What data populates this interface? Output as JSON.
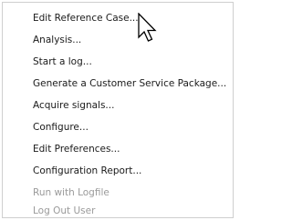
{
  "menu": {
    "items": [
      {
        "label": "Edit Reference Case...",
        "enabled": true
      },
      {
        "label": "Analysis...",
        "enabled": true
      },
      {
        "label": "Start a log...",
        "enabled": true
      },
      {
        "label": "Generate a Customer Service Package...",
        "enabled": true
      },
      {
        "label": "Acquire signals...",
        "enabled": true
      },
      {
        "label": "Configure...",
        "enabled": true
      },
      {
        "label": "Edit Preferences...",
        "enabled": true
      },
      {
        "label": "Configuration Report...",
        "enabled": true
      },
      {
        "label": "Run with Logfile",
        "enabled": false
      },
      {
        "label": "Log Out User",
        "enabled": false
      }
    ]
  },
  "cursor": {
    "icon": "arrow-pointer-icon"
  }
}
